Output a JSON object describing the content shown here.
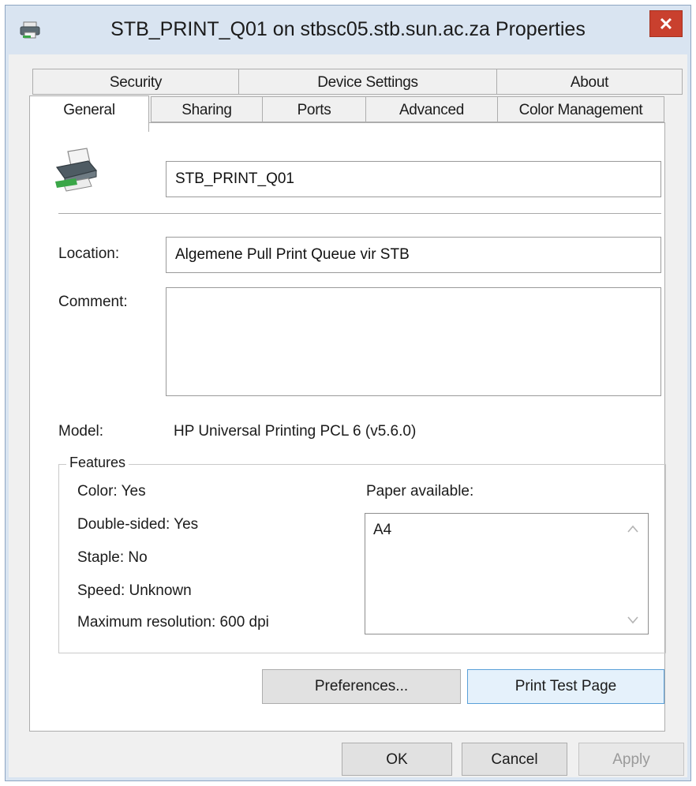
{
  "window": {
    "title": "STB_PRINT_Q01 on stbsc05.stb.sun.ac.za Properties",
    "close_glyph": "✕"
  },
  "tabs_row1": [
    {
      "label": "Security"
    },
    {
      "label": "Device Settings"
    },
    {
      "label": "About"
    }
  ],
  "tabs_row2": [
    {
      "label": "General",
      "active": true
    },
    {
      "label": "Sharing"
    },
    {
      "label": "Ports"
    },
    {
      "label": "Advanced"
    },
    {
      "label": "Color Management"
    }
  ],
  "general": {
    "printer_name": "STB_PRINT_Q01",
    "location_label": "Location:",
    "location_value": "Algemene Pull Print Queue vir STB",
    "comment_label": "Comment:",
    "comment_value": "",
    "model_label": "Model:",
    "model_value": "HP Universal Printing PCL 6 (v5.6.0)"
  },
  "features": {
    "title": "Features",
    "color": "Color: Yes",
    "double_sided": "Double-sided: Yes",
    "staple": "Staple: No",
    "speed": "Speed: Unknown",
    "max_resolution": "Maximum resolution: 600 dpi",
    "paper_label": "Paper available:",
    "paper_items": [
      "A4"
    ]
  },
  "buttons": {
    "preferences": "Preferences...",
    "print_test": "Print Test Page",
    "ok": "OK",
    "cancel": "Cancel",
    "apply": "Apply"
  },
  "icons": {
    "title": "printer-icon",
    "printer": "printer-icon",
    "scroll_up": "chevron-up-icon",
    "scroll_down": "chevron-down-icon"
  }
}
